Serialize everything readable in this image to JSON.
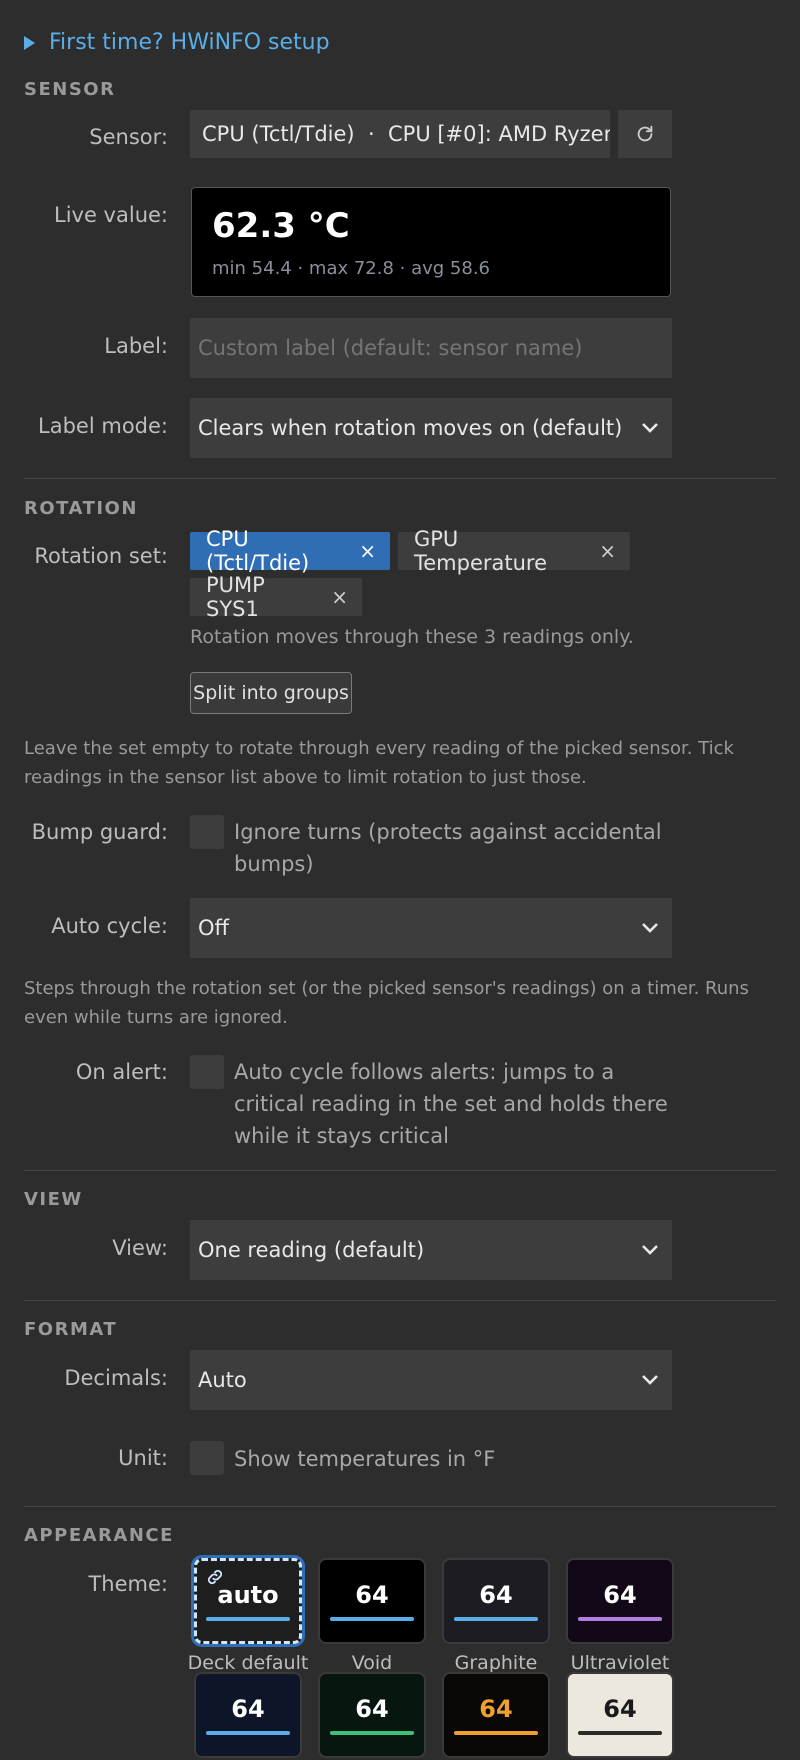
{
  "setup": {
    "label": "First time? HWiNFO setup"
  },
  "sensor_section": {
    "title": "SENSOR",
    "sensor_label": "Sensor:",
    "sensor_value": "CPU (Tctl/Tdie)  ·  CPU [#0]: AMD Ryzen",
    "live_label": "Live value:",
    "live_value": "62.3 °C",
    "live_stats": "min 54.4 · max 72.8 · avg 58.6",
    "label_label": "Label:",
    "label_placeholder": "Custom label (default: sensor name)",
    "label_mode_label": "Label mode:",
    "label_mode_value": "Clears when rotation moves on (default)"
  },
  "rotation_section": {
    "title": "ROTATION",
    "set_label": "Rotation set:",
    "chips": [
      "CPU (Tctl/Tdie)",
      "GPU Temperature",
      "PUMP SYS1"
    ],
    "chip_remove": "×",
    "set_note": "Rotation moves through these 3 readings only.",
    "split_button": "Split into groups",
    "empty_note": "Leave the set empty to rotate through every reading of the picked sensor. Tick readings in the sensor list above to limit rotation to just those.",
    "bump_label": "Bump guard:",
    "bump_text": "Ignore turns (protects against accidental bumps)",
    "auto_label": "Auto cycle:",
    "auto_value": "Off",
    "auto_note": "Steps through the rotation set (or the picked sensor's readings) on a timer. Runs even while turns are ignored.",
    "alert_label": "On alert:",
    "alert_text": "Auto cycle follows alerts: jumps to a critical reading in the set and holds there while it stays critical"
  },
  "view_section": {
    "title": "VIEW",
    "view_label": "View:",
    "view_value": "One reading (default)"
  },
  "format_section": {
    "title": "FORMAT",
    "decimals_label": "Decimals:",
    "decimals_value": "Auto",
    "unit_label": "Unit:",
    "unit_text": "Show temperatures in °F"
  },
  "appearance_section": {
    "title": "APPEARANCE",
    "theme_label": "Theme:",
    "themes": [
      {
        "name": "Deck default",
        "value": "auto",
        "bg": "#1e1e1e",
        "text": "#ffffff",
        "bar": "#5aaee8",
        "selected": true
      },
      {
        "name": "Void",
        "value": "64",
        "bg": "#000000",
        "text": "#ffffff",
        "bar": "#5aaee8"
      },
      {
        "name": "Graphite",
        "value": "64",
        "bg": "#1c1c22",
        "text": "#ffffff",
        "bar": "#5aaee8"
      },
      {
        "name": "Ultraviolet",
        "value": "64",
        "bg": "#120818",
        "text": "#ffffff",
        "bar": "#b07ee0"
      },
      {
        "name": "",
        "value": "64",
        "bg": "#0c1628",
        "text": "#ffffff",
        "bar": "#5aaee8"
      },
      {
        "name": "",
        "value": "64",
        "bg": "#071710",
        "text": "#ffffff",
        "bar": "#3fc07a"
      },
      {
        "name": "",
        "value": "64",
        "bg": "#0a0806",
        "text": "#f0a030",
        "bar": "#f0a030"
      },
      {
        "name": "",
        "value": "64",
        "bg": "#ece8de",
        "text": "#1a1a1a",
        "bar": "#2a2a2a"
      }
    ]
  },
  "colors": {
    "accent": "#5aaee8",
    "chip_selected": "#2f6eb5",
    "panel": "#2d2d2d",
    "field": "#3d3d3d"
  },
  "icons": [
    "triangle-right-icon",
    "refresh-icon",
    "chevron-down-icon",
    "close-icon",
    "link-icon"
  ]
}
